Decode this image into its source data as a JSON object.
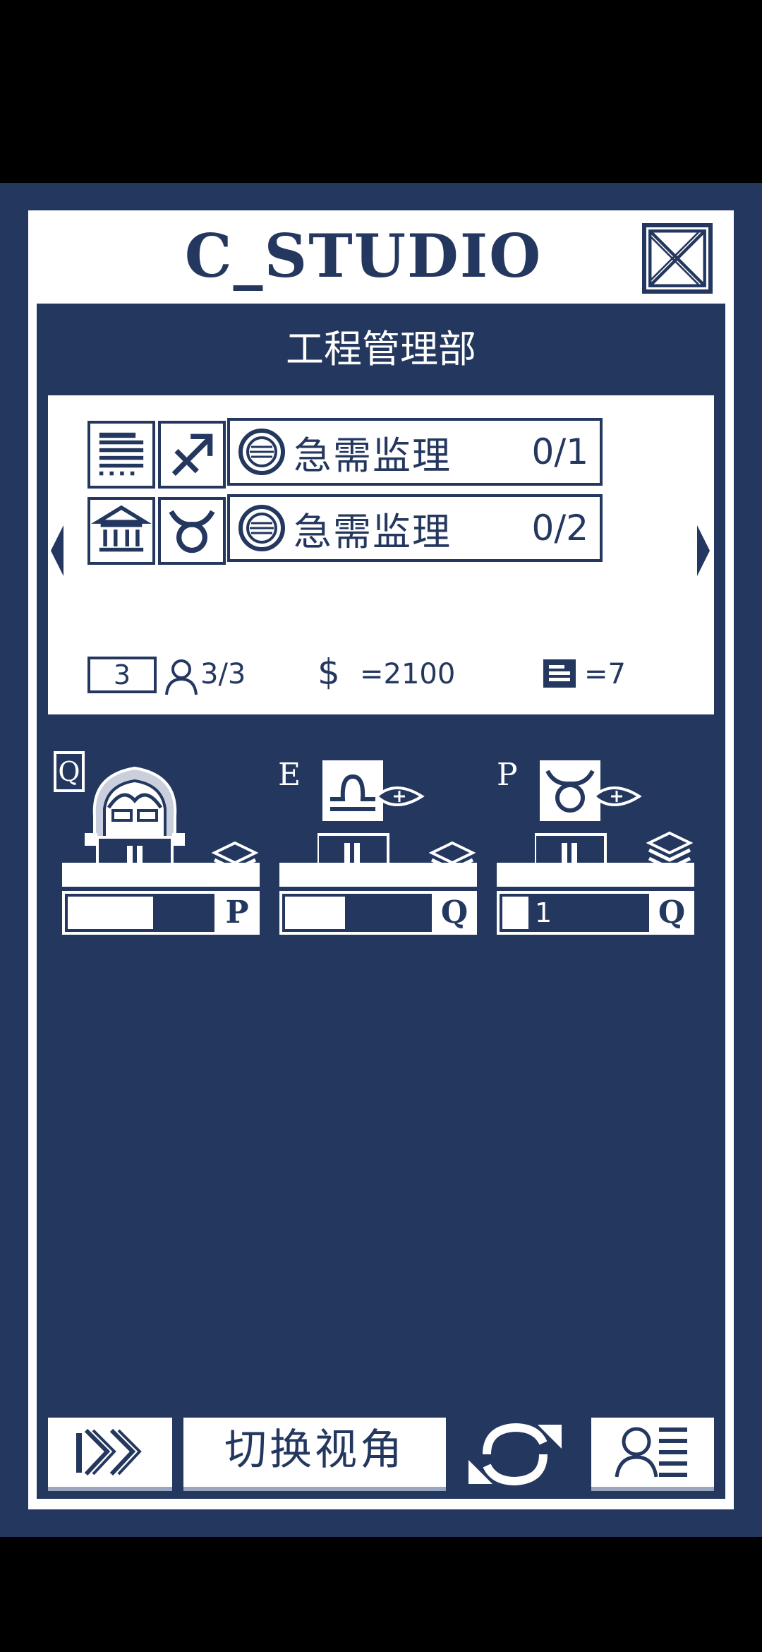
{
  "app": {
    "title": "C_STUDIO",
    "department": "工程管理部",
    "colors": {
      "navy": "#24375f",
      "white": "#ffffff",
      "black": "#000000"
    }
  },
  "tasks": [
    {
      "building_icon": "construction-icon",
      "sign_icon": "sagittarius-icon",
      "name": "急需监理",
      "count": "0/1"
    },
    {
      "building_icon": "temple-icon",
      "sign_icon": "taurus-icon",
      "name": "急需监理",
      "count": "0/2"
    }
  ],
  "stats": {
    "level": "3",
    "staff": "3/3",
    "money": "=2100",
    "documents": "=7"
  },
  "desks": [
    {
      "label": "Q",
      "hotkey": "P",
      "progress": 0.58,
      "occupied": true,
      "bar_text": ""
    },
    {
      "label": "E",
      "hotkey": "Q",
      "progress": 0.41,
      "occupied": false,
      "sign_icon": "libra-icon",
      "bar_text": ""
    },
    {
      "label": "P",
      "hotkey": "Q",
      "progress": 0.18,
      "occupied": false,
      "sign_icon": "taurus-icon",
      "bar_text": "1"
    }
  ],
  "toolbar": {
    "fast_forward_icon": "fast-forward-icon",
    "switch_view_label": "切换视角",
    "refresh_icon": "refresh-icon",
    "staff_icon": "staff-profile-icon"
  }
}
